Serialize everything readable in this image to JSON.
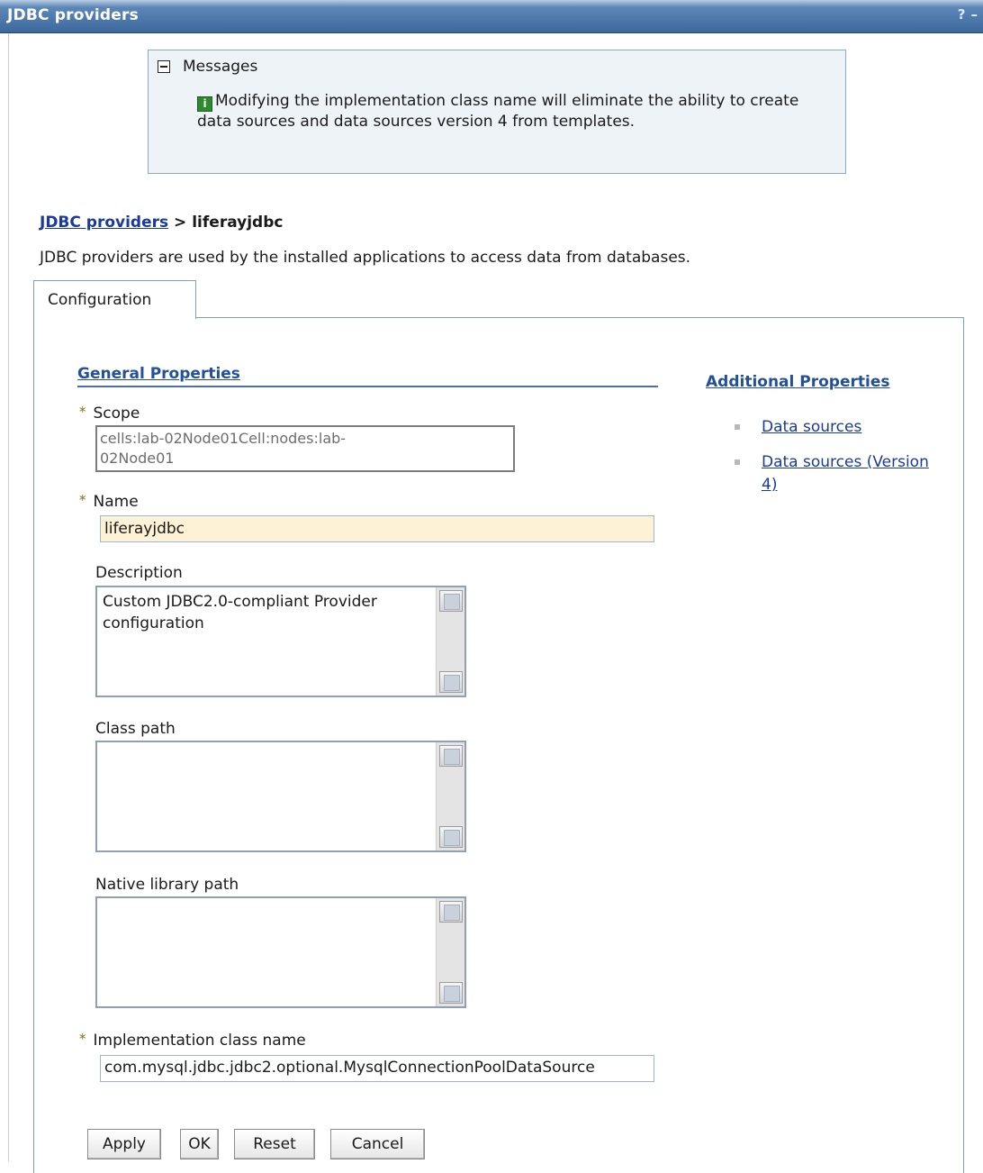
{
  "window": {
    "title": "JDBC providers",
    "help_icon": "?",
    "minimize_icon": "–"
  },
  "messages": {
    "header": "Messages",
    "text": "Modifying the implementation class name will eliminate the ability to create data sources and data sources version 4 from templates.",
    "icon": "info-icon"
  },
  "breadcrumb": {
    "link": "JDBC providers",
    "separator": " > ",
    "current": "liferayjdbc"
  },
  "intro": "JDBC providers are used by the installed applications to access data from databases.",
  "tabs": [
    {
      "label": "Configuration"
    }
  ],
  "general_properties": {
    "title": "General Properties",
    "required_marker": "*",
    "scope": {
      "label": "Scope",
      "value_line1": "cells:lab-02Node01Cell:nodes:lab-",
      "value_line2": "02Node01"
    },
    "name": {
      "label": "Name",
      "value": "liferayjdbc"
    },
    "description": {
      "label": "Description",
      "value": "Custom JDBC2.0-compliant Provider configuration"
    },
    "class_path": {
      "label": "Class path",
      "value": ""
    },
    "native_library_path": {
      "label": "Native library path",
      "value": ""
    },
    "implementation_class_name": {
      "label": "Implementation class name",
      "value": "com.mysql.jdbc.jdbc2.optional.MysqlConnectionPoolDataSource"
    }
  },
  "additional_properties": {
    "title": "Additional Properties",
    "links": [
      {
        "label": "Data sources"
      },
      {
        "label": "Data sources (Version 4)"
      }
    ]
  },
  "buttons": {
    "apply": "Apply",
    "ok": "OK",
    "reset": "Reset",
    "cancel": "Cancel"
  }
}
